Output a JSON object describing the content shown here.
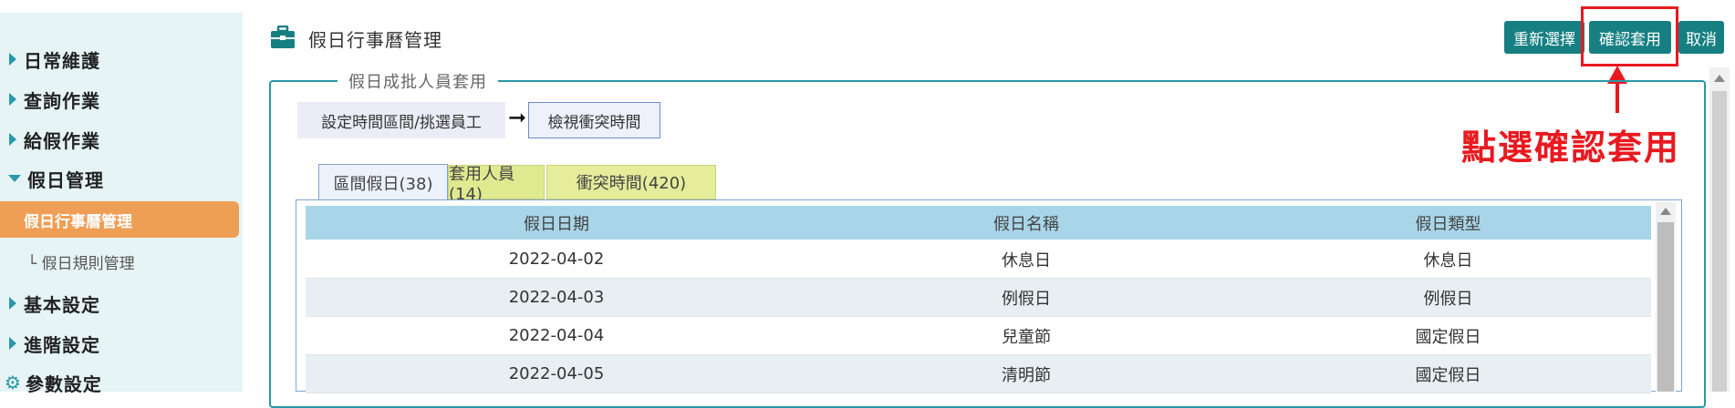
{
  "sidebar": {
    "items": [
      {
        "label": "日常維護"
      },
      {
        "label": "查詢作業"
      },
      {
        "label": "給假作業"
      },
      {
        "label": "假日管理"
      },
      {
        "label": "基本設定"
      },
      {
        "label": "進階設定"
      },
      {
        "label": "參數設定"
      }
    ],
    "active": "假日行事曆管理",
    "sub": "└ 假日規則管理"
  },
  "header": {
    "title": "假日行事曆管理",
    "buttons": {
      "reset": "重新選擇",
      "apply": "確認套用",
      "cancel": "取消"
    }
  },
  "annotation": {
    "text": "點選確認套用",
    "color": "#e8191f"
  },
  "fieldset": {
    "legend": "假日成批人員套用"
  },
  "steps": {
    "step1": "設定時間區間/挑選員工",
    "arrow": "➞",
    "step2": "檢視衝突時間"
  },
  "tabs": [
    {
      "label": "區間假日(38)"
    },
    {
      "label": "套用人員(14)"
    },
    {
      "label": "衝突時間(420)"
    }
  ],
  "table": {
    "headers": [
      "假日日期",
      "假日名稱",
      "假日類型"
    ],
    "rows": [
      [
        "2022-04-02",
        "休息日",
        "休息日"
      ],
      [
        "2022-04-03",
        "例假日",
        "例假日"
      ],
      [
        "2022-04-04",
        "兒童節",
        "國定假日"
      ],
      [
        "2022-04-05",
        "清明節",
        "國定假日"
      ]
    ]
  },
  "colors": {
    "accent": "#167f82",
    "active_nav": "#ef9e55",
    "sidebar_bg": "#e6f4f6",
    "table_header": "#a9d5e8"
  }
}
